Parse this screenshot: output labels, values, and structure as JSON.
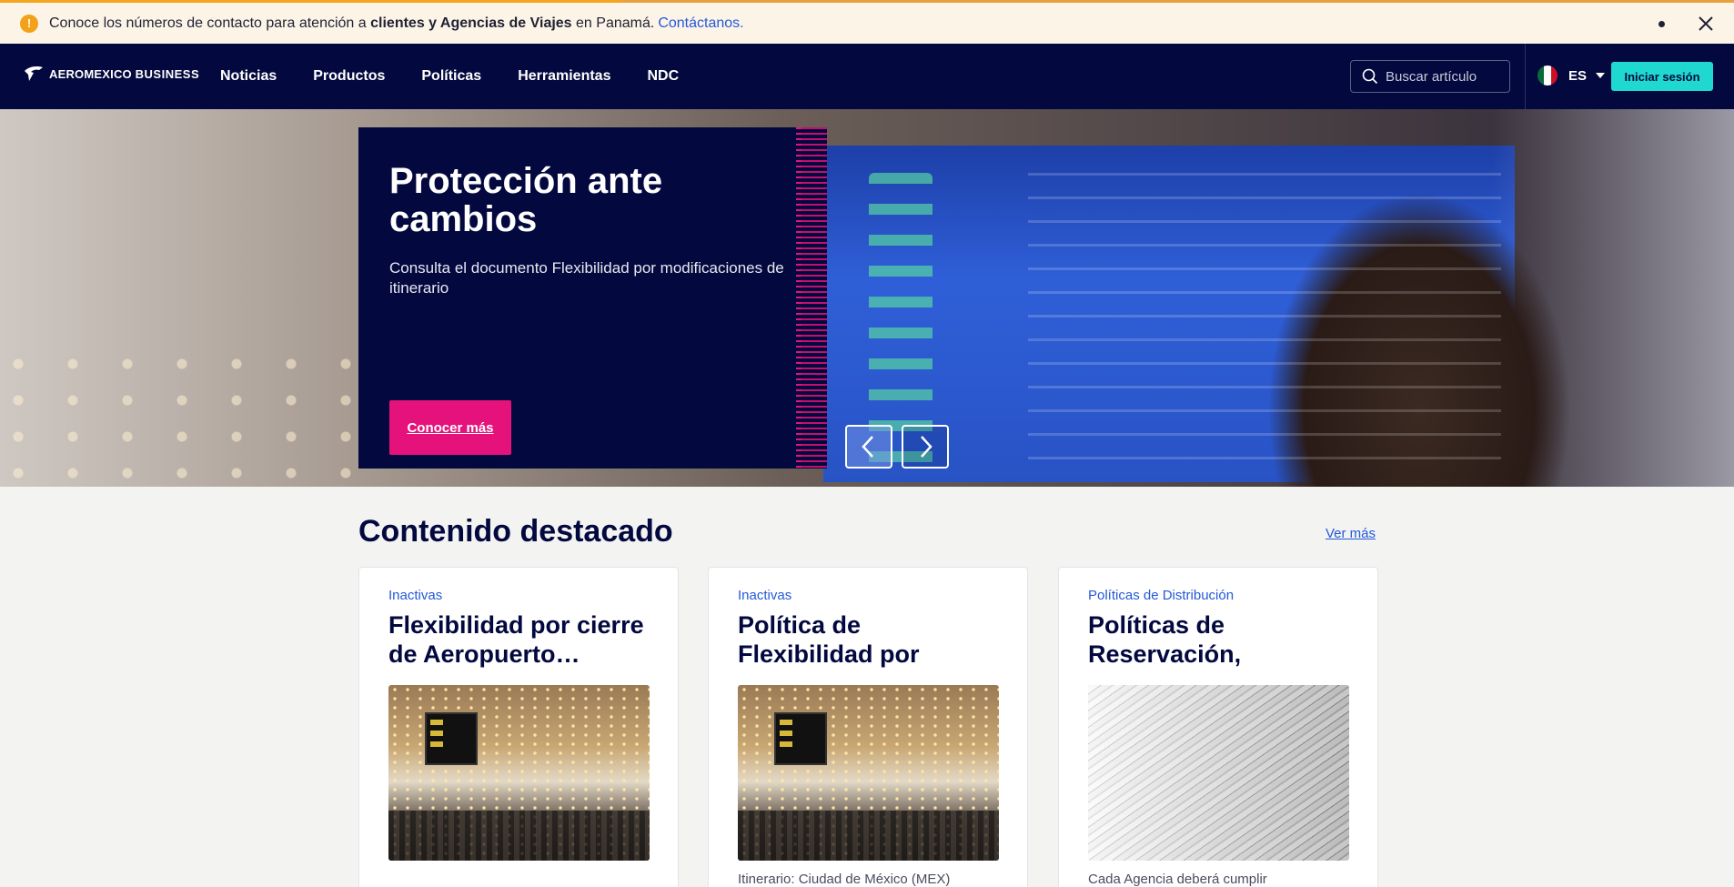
{
  "alert": {
    "text_before": "Conoce los números de contacto para atención a",
    "text_bold": "clientes y Agencias de Viajes",
    "text_after": "en Panamá.",
    "link": "Contáctanos."
  },
  "nav": {
    "logo_text": "AEROMEXICO",
    "logo_sub": "BUSINESS",
    "items": [
      "Noticias",
      "Productos",
      "Políticas",
      "Herramientas",
      "NDC"
    ],
    "search_placeholder": "Buscar artículo",
    "lang": "ES",
    "login": "Iniciar sesión"
  },
  "hero": {
    "title": "Protección ante cambios",
    "subtitle": "Consulta el documento Flexibilidad por modificaciones de itinerario",
    "button": "Conocer más",
    "slides_total": 5,
    "active_slide": 4
  },
  "featured": {
    "title": "Contenido destacado",
    "more": "Ver más",
    "cards": [
      {
        "category": "Inactivas",
        "title": "Flexibilidad por cierre de Aeropuerto…",
        "excerpt": "",
        "image": "airport-terminal"
      },
      {
        "category": "Inactivas",
        "title": "Política de Flexibilidad por Bloqueos Viales e…",
        "excerpt": "Itinerario: Ciudad de México (MEX)",
        "image": "airport-terminal"
      },
      {
        "category": "Políticas de Distribución",
        "title": "Políticas de Reservación, Emisión…",
        "excerpt": "Cada Agencia deberá cumplir",
        "image": "paper-stack"
      }
    ]
  },
  "colors": {
    "navy": "#03093f",
    "magenta": "#e6127b",
    "teal": "#1fd8d0",
    "link_blue": "#2459d9",
    "alert_orange": "#f2a118"
  }
}
